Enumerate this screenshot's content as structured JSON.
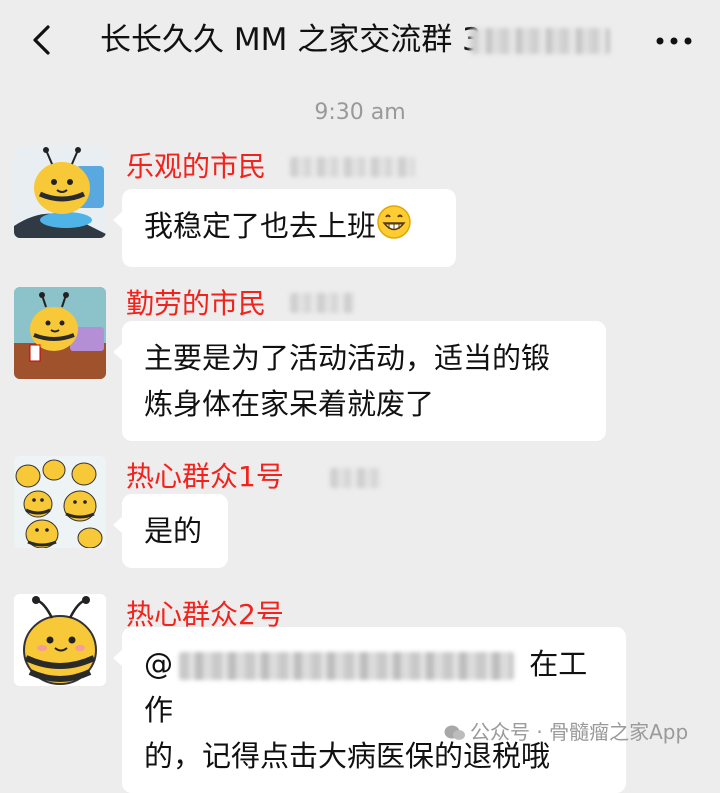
{
  "header": {
    "title": "长长久久 MM 之家交流群 3"
  },
  "timestamp": "9:30 am",
  "messages": [
    {
      "sender": "乐观的市民",
      "text": "我稳定了也去上班",
      "emoji": "grinning-face-emoji"
    },
    {
      "sender": "勤劳的市民",
      "line1": "主要是为了活动活动，适当的锻",
      "line2": "炼身体在家呆着就废了"
    },
    {
      "sender": "热心群众1号",
      "text": "是的"
    },
    {
      "sender": "热心群众2号",
      "at": "@",
      "line1_tail": " 在工作",
      "line2": "的，记得点击大病医保的退税哦"
    }
  ],
  "watermark": "公众号 · 骨髓瘤之家App",
  "colors": {
    "sender_name": "#f2231d",
    "background": "#ededed",
    "bubble": "#ffffff"
  }
}
